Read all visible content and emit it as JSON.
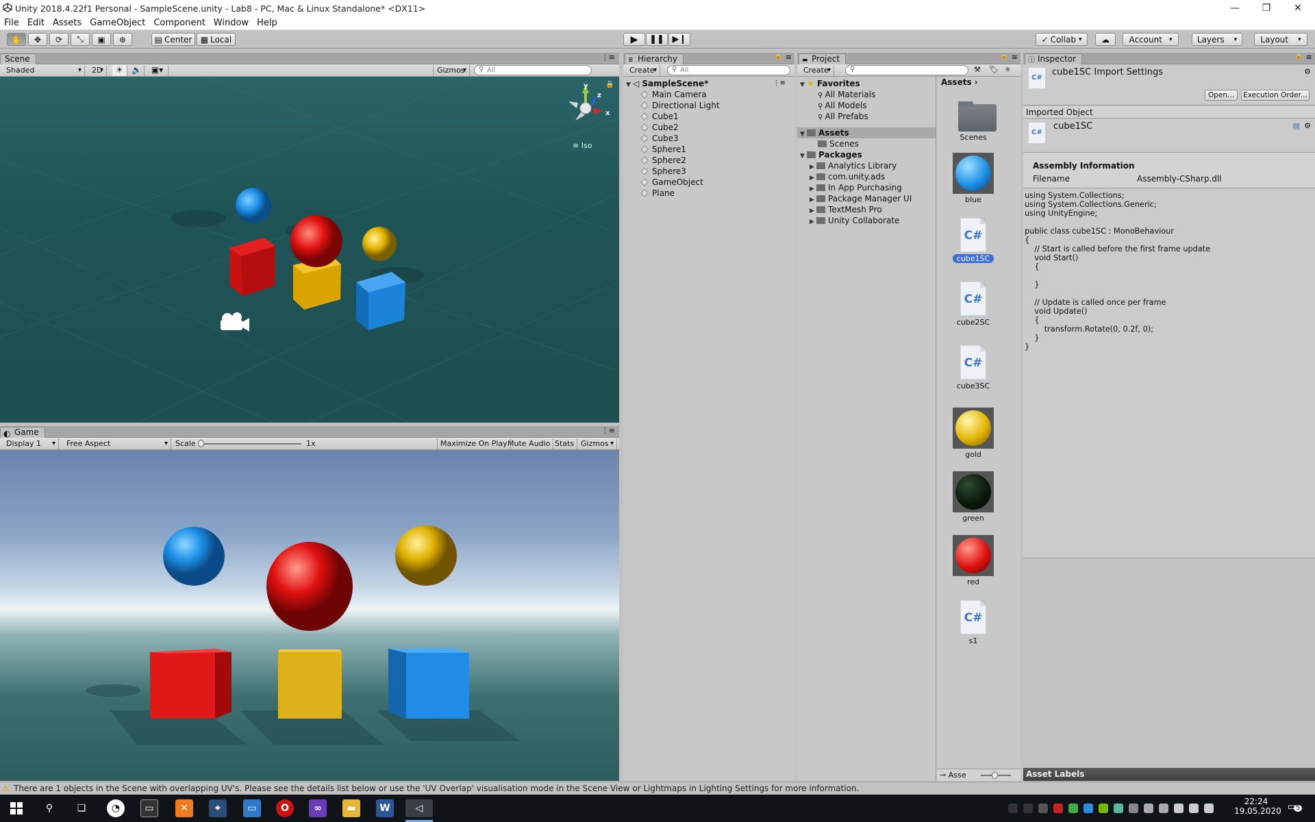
{
  "window": {
    "title": "Unity 2018.4.22f1 Personal - SampleScene.unity - Lab8 - PC, Mac & Linux Standalone* <DX11>"
  },
  "menu": [
    "File",
    "Edit",
    "Assets",
    "GameObject",
    "Component",
    "Window",
    "Help"
  ],
  "toolbar": {
    "pivot": "Center",
    "space": "Local",
    "collab": "Collab",
    "account": "Account",
    "layers": "Layers",
    "layout": "Layout"
  },
  "scene": {
    "tab": "Scene",
    "shading": "Shaded",
    "mode2d": "2D",
    "gizmos": "Gizmos",
    "search_placeholder": "All",
    "iso": "Iso",
    "gizmo_x": "x",
    "gizmo_y": "y",
    "gizmo_z": "z"
  },
  "game": {
    "tab": "Game",
    "display": "Display 1",
    "aspect": "Free Aspect",
    "scale_label": "Scale",
    "scale_value": "1x",
    "maximize": "Maximize On Play",
    "mute": "Mute Audio",
    "stats": "Stats",
    "gizmos": "Gizmos"
  },
  "hierarchy": {
    "tab": "Hierarchy",
    "create": "Create",
    "search_placeholder": "All",
    "scene_name": "SampleScene*",
    "items": [
      "Main Camera",
      "Directional Light",
      "Cube1",
      "Cube2",
      "Cube3",
      "Sphere1",
      "Sphere2",
      "Sphere3",
      "GameObject",
      "Plane"
    ]
  },
  "project": {
    "tab": "Project",
    "create": "Create",
    "favorites": "Favorites",
    "favorite_items": [
      "All Materials",
      "All Models",
      "All Prefabs"
    ],
    "assets_root": "Assets",
    "assets_children": [
      "Scenes"
    ],
    "packages": "Packages",
    "package_items": [
      "Analytics Library",
      "com.unity.ads",
      "In App Purchasing",
      "Package Manager UI",
      "TextMesh Pro",
      "Unity Collaborate"
    ],
    "breadcrumb": "Assets",
    "grid_items": [
      {
        "name": "Scenes",
        "kind": "folder"
      },
      {
        "name": "blue",
        "kind": "material",
        "color": "#1e8fe6"
      },
      {
        "name": "cube1SC",
        "kind": "script",
        "selected": true
      },
      {
        "name": "cube2SC",
        "kind": "script"
      },
      {
        "name": "cube3SC",
        "kind": "script"
      },
      {
        "name": "gold",
        "kind": "material",
        "color": "#e2b400"
      },
      {
        "name": "green",
        "kind": "material",
        "color": "#0c1a0e"
      },
      {
        "name": "red",
        "kind": "material",
        "color": "#e01010"
      },
      {
        "name": "s1",
        "kind": "script"
      }
    ],
    "bottom_label": "Asse",
    "cs_glyph": "C#"
  },
  "inspector": {
    "tab": "Inspector",
    "title": "cube1SC Import Settings",
    "open_button": "Open...",
    "exec_order_button": "Execution Order...",
    "imported_object": "Imported Object",
    "object_name": "cube1SC",
    "assembly_header": "Assembly Information",
    "filename_label": "Filename",
    "filename_value": "Assembly-CSharp.dll",
    "code": "using System.Collections;\nusing System.Collections.Generic;\nusing UnityEngine;\n\npublic class cube1SC : MonoBehaviour\n{\n    // Start is called before the first frame update\n    void Start()\n    {\n\n    }\n\n    // Update is called once per frame\n    void Update()\n    {\n        transform.Rotate(0, 0.2f, 0);\n    }\n}",
    "asset_labels": "Asset Labels"
  },
  "status": {
    "message": "There are 1 objects in the Scene with overlapping UV's. Please see the details list below or use the 'UV Overlap' visualisation mode in the Scene View or Lightmaps in Lighting Settings for more information."
  },
  "taskbar": {
    "time": "22:24",
    "date": "19.05.2020",
    "notifications": "5"
  },
  "colors": {
    "accent": "#3d6fd6",
    "scene_bg": "#1e4a4c",
    "red": "#e01010",
    "gold": "#e2b400",
    "blue": "#1e8fe6"
  }
}
